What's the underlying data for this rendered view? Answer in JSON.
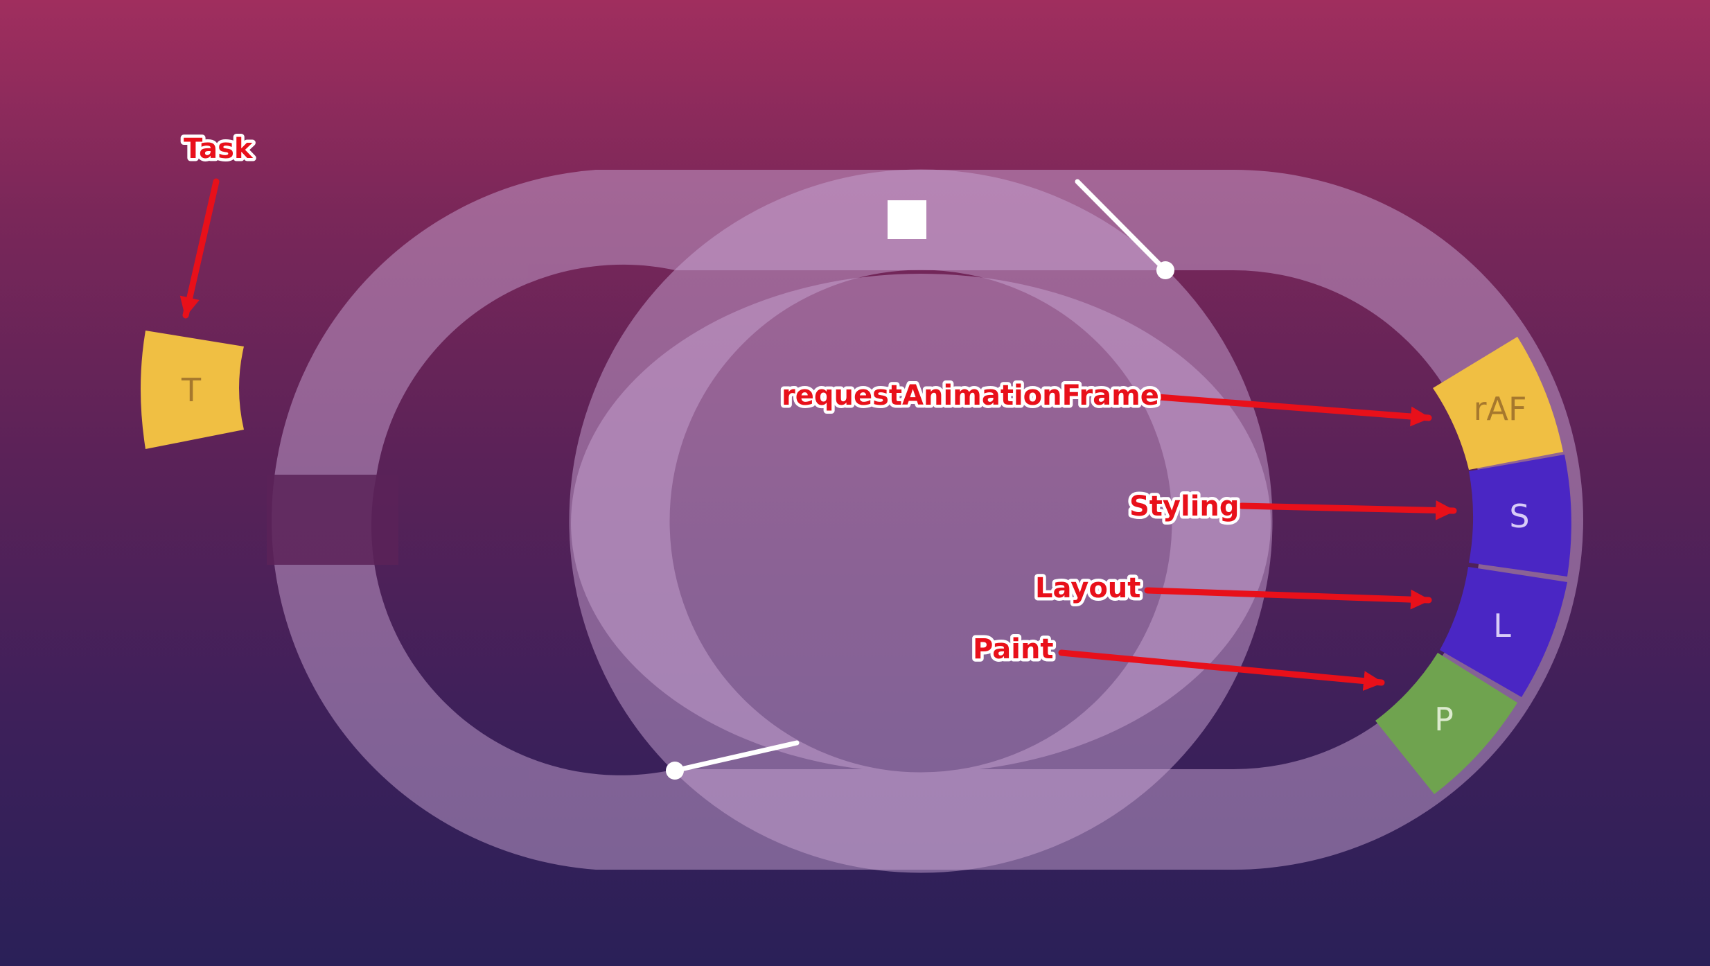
{
  "colors": {
    "track": "#c8a3d2",
    "task": "#f0bf43",
    "raf": "#f0bf43",
    "styling": "#4a26c4",
    "layout": "#4a26c4",
    "paint": "#6fa34f",
    "annotation": "#e8101a",
    "pointer": "#ffffff"
  },
  "segments": {
    "task": "T",
    "raf": "rAF",
    "styling": "S",
    "layout": "L",
    "paint": "P"
  },
  "annotations": {
    "task": "Task",
    "raf": "requestAnimationFrame",
    "styling": "Styling",
    "layout": "Layout",
    "paint": "Paint"
  },
  "icons": {
    "center": "stop-square-icon"
  }
}
